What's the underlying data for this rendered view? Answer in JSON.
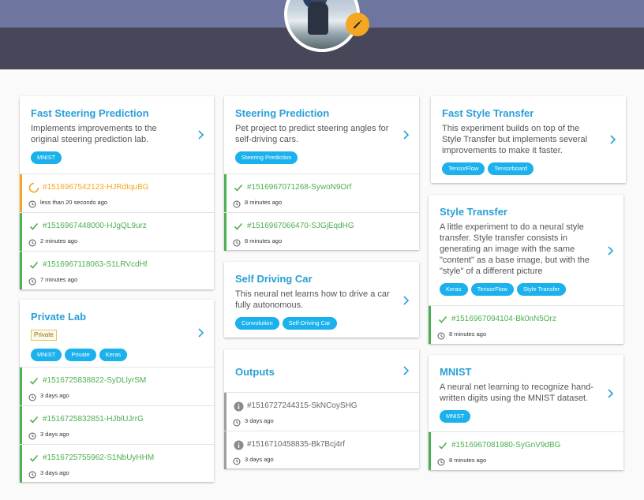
{
  "colors": {
    "green": "#4caf50",
    "orange": "#f5a623",
    "gray": "#9e9e9e",
    "link": "#2a9fd6",
    "tag": "#1ab1ec"
  },
  "profile": {
    "edit_icon": "pencil-icon"
  },
  "cards": {
    "fast_steering": {
      "title": "Fast Steering Prediction",
      "description": "Implements improvements to the original steering prediction lab.",
      "tags": [
        "MNIST"
      ],
      "runs": [
        {
          "id": "#1516967542123-HJRdIquBG",
          "time": "less than 20 seconds ago",
          "status": "running"
        },
        {
          "id": "#1516967448000-HJgQL9urz",
          "time": "2 minutes ago",
          "status": "success"
        },
        {
          "id": "#1516967118063-S1LRVcdHf",
          "time": "7 minutes ago",
          "status": "success"
        }
      ]
    },
    "private_lab": {
      "title": "Private Lab",
      "badge": "Private",
      "tags": [
        "MNIST",
        "Private",
        "Keras"
      ],
      "runs": [
        {
          "id": "#1516725838822-SyDLlyrSM",
          "time": "3 days ago",
          "status": "success"
        },
        {
          "id": "#1516725832851-HJblUJrrG",
          "time": "3 days ago",
          "status": "success"
        },
        {
          "id": "#1516725755962-S1NbUyHHM",
          "time": "3 days ago",
          "status": "success"
        }
      ]
    },
    "steering": {
      "title": "Steering Prediction",
      "description": "Pet project to predict steering angles for self-driving cars.",
      "tags": [
        "Steering Prediction"
      ],
      "runs": [
        {
          "id": "#1516967071268-SywoN9Orf",
          "time": "8 minutes ago",
          "status": "success"
        },
        {
          "id": "#1516967066470-SJGjEqdHG",
          "time": "8 minutes ago",
          "status": "success"
        }
      ]
    },
    "self_driving": {
      "title": "Self Driving Car",
      "description": "This neural net learns how to drive a car fully autonomous.",
      "tags": [
        "Convolution",
        "Self-Driving Car"
      ]
    },
    "outputs": {
      "title": "Outputs",
      "runs": [
        {
          "id": "#1516727244315-SkNCoySHG",
          "time": "3 days ago",
          "status": "info"
        },
        {
          "id": "#1516710458835-Bk7Bcj4rf",
          "time": "3 days ago",
          "status": "info"
        }
      ]
    },
    "fast_style": {
      "title": "Fast Style Transfer",
      "description": "This experiment builds on top of the Style Transfer but implements several improvements to make it faster.",
      "tags": [
        "TensorFlow",
        "Tensorboard"
      ]
    },
    "style_transfer": {
      "title": "Style Transfer",
      "description": "A little experiment to do a neural style transfer. Style transfer consists in generating an image with the same \"content\" as a base image, but with the \"style\" of a different picture",
      "tags": [
        "Keras",
        "TensorFlow",
        "Style Transfer"
      ],
      "runs": [
        {
          "id": "#1516967094104-Bk0nN5Orz",
          "time": "8 minutes ago",
          "status": "success"
        }
      ]
    },
    "mnist": {
      "title": "MNIST",
      "description": "A neural net learning to recognize hand-written digits using the MNIST dataset.",
      "tags": [
        "MNIST"
      ],
      "runs": [
        {
          "id": "#1516967081980-SyGnV9dBG",
          "time": "8 minutes ago",
          "status": "success"
        }
      ]
    }
  }
}
